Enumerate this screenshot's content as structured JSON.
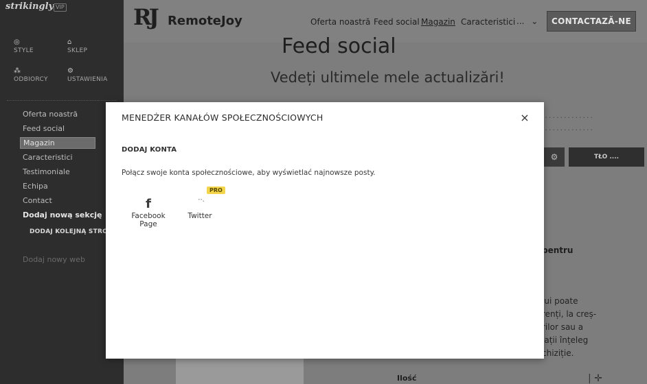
{
  "sidebar": {
    "brand": "strikingly",
    "brand_badge": "VIP",
    "tools": [
      {
        "label": "STYLE",
        "icon": "palette-icon"
      },
      {
        "label": "SKLEP",
        "icon": "shop-icon"
      },
      {
        "label": "ODBIORCY",
        "icon": "audience-icon"
      },
      {
        "label": "USTAWIENIA",
        "icon": "settings-icon"
      }
    ],
    "nav": [
      "Oferta noastră",
      "Feed social",
      "Magazin",
      "Caracteristici",
      "Testimoniale",
      "Echipa",
      "Contact"
    ],
    "add_section": "Dodaj nową sekcję",
    "add_page": "DODAJ KOLEJNĄ STRONĘ",
    "faded_item": "Dodaj nowy web"
  },
  "site": {
    "logo_mark": "RJ",
    "logo_text": "RemoteJoy",
    "nav": [
      "Oferta noastră",
      "Feed social",
      "Magazin",
      "Caracteristici"
    ],
    "more": "...",
    "cta": "CONTACTAZĂ-NE",
    "title": "Feed social",
    "subtitle": "Vedeți ultimele mele actualizări!",
    "bg_button": "TŁO ....",
    "heading_fragment": "pentru",
    "para_lines": [
      "lui poate",
      "renți, la creș-",
      "rilor sau a",
      "iații înțeleg",
      "chiziție."
    ],
    "ilosc": "Ilość"
  },
  "modal": {
    "title": "MENEDŻER KANAŁÓW SPOŁECZNOŚCIOWYCH",
    "close": "×",
    "section_title": "DODAJ KONTA",
    "description": "Połącz swoje konta społecznościowe, aby wyświetlać najnowsze posty.",
    "accounts": [
      {
        "label_line1": "Facebook",
        "label_line2": "Page",
        "icon": "facebook-icon"
      },
      {
        "label_line1": "Twitter",
        "label_line2": "",
        "icon": "twitter-icon",
        "badge": "PRO"
      }
    ]
  }
}
